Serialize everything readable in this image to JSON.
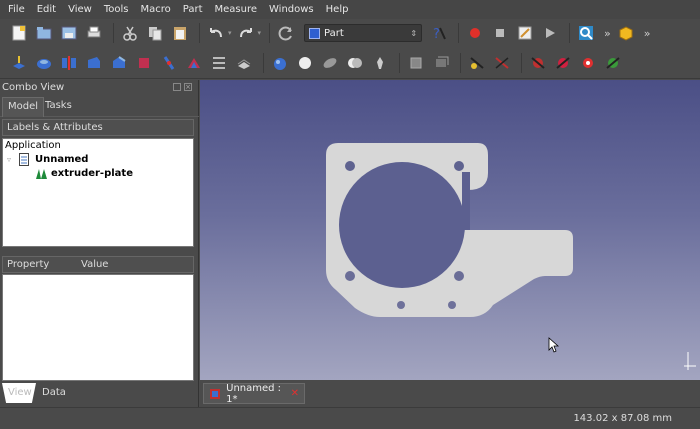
{
  "menu": [
    "File",
    "Edit",
    "View",
    "Tools",
    "Macro",
    "Part",
    "Measure",
    "Windows",
    "Help"
  ],
  "toolbar": {
    "workbench": "Part",
    "file_tools": [
      "new-file-icon",
      "open-file-icon",
      "save-file-icon",
      "print-icon"
    ],
    "edit_tools": [
      "cut-icon",
      "copy-icon",
      "paste-icon",
      "undo-icon",
      "redo-icon",
      "refresh-icon"
    ],
    "macro_tools": [
      "record-macro-icon",
      "stop-macro-icon",
      "edit-macro-icon",
      "run-macro-icon"
    ]
  },
  "combo_view": {
    "title": "Combo View",
    "tabs": [
      "Model",
      "Tasks"
    ],
    "tree_header": "Labels & Attributes",
    "tree": {
      "root": "Application",
      "document": "Unnamed",
      "object": "extruder-plate"
    },
    "property_columns": [
      "Property",
      "Value"
    ],
    "bottom_tabs": [
      "View",
      "Data"
    ]
  },
  "document_tab": {
    "label": "Unnamed : 1*"
  },
  "status": {
    "dimensions": "143.02 x 87.08 mm"
  },
  "colors": {
    "viewport_top": "#4b4f86",
    "viewport_bottom": "#a3a5c0",
    "part_fill": "#d7d7d7",
    "record": "#e0302a"
  }
}
